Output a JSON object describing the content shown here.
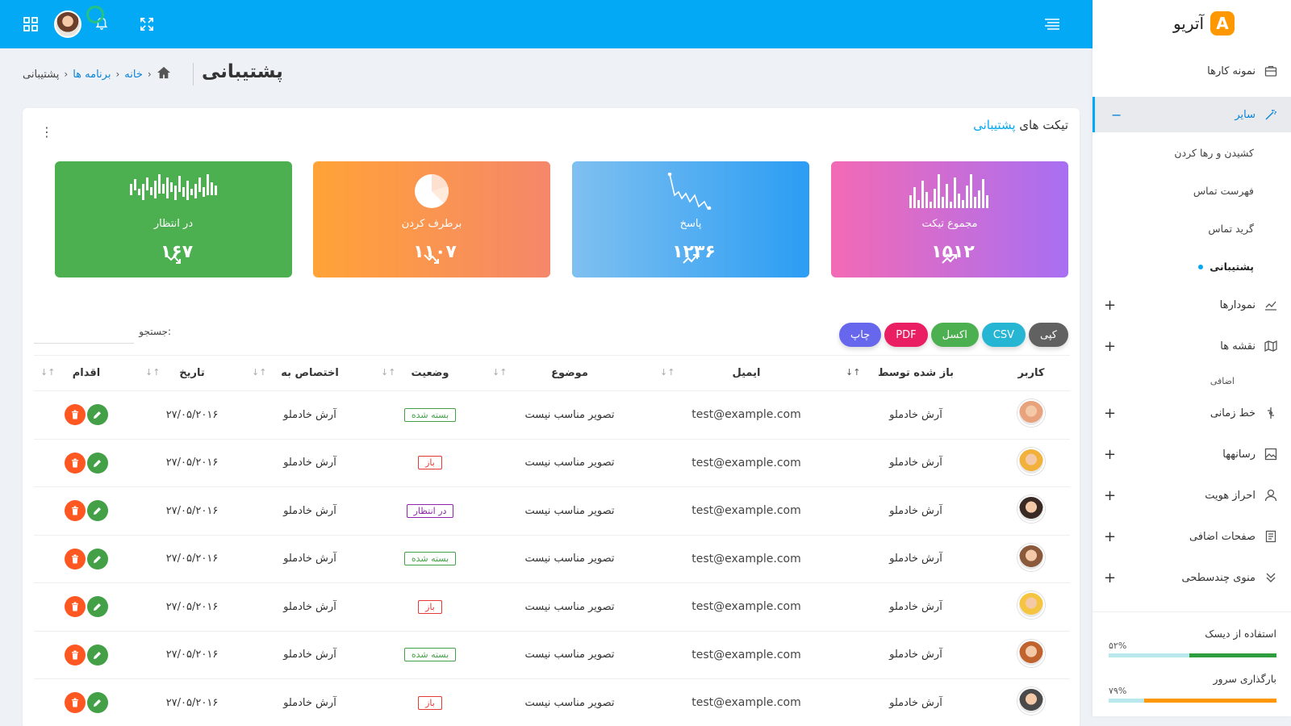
{
  "app": {
    "name": "آتریو",
    "logo_letter": "A"
  },
  "topbar": {
    "icons": [
      "grid-icon",
      "avatar",
      "bell-icon",
      "expand-icon",
      "menu-icon"
    ]
  },
  "page": {
    "title": "پشتیبانی",
    "breadcrumb": [
      "خانه",
      "برنامه ها",
      "پشتیبانی"
    ]
  },
  "sidebar": {
    "items": [
      {
        "label": "نمونه کارها",
        "icon": "briefcase-icon"
      },
      {
        "label": "سایر",
        "icon": "magic-wand-icon",
        "active": true
      }
    ],
    "subitems": [
      "کشیدن و رها کردن",
      "فهرست تماس",
      "گرید تماس",
      "پشتیبانی"
    ],
    "items2": [
      {
        "label": "نمودارها",
        "icon": "chart-line-icon"
      },
      {
        "label": "نقشه ها",
        "icon": "map-icon"
      }
    ],
    "section_label": "اضافی",
    "items3": [
      {
        "label": "خط زمانی",
        "icon": "timeline-icon"
      },
      {
        "label": "رسانهها",
        "icon": "image-icon"
      },
      {
        "label": "احراز هویت",
        "icon": "user-icon"
      },
      {
        "label": "صفحات اضافی",
        "icon": "page-icon"
      },
      {
        "label": "منوی چندسطحی",
        "icon": "chevrons-down-icon"
      }
    ],
    "meters": [
      {
        "label": "استفاده از دیسک",
        "percent": "۵۲%",
        "value": 52,
        "color": "#2e9e3e"
      },
      {
        "label": "بارگذاری سرور",
        "percent": "۷۹%",
        "value": 79,
        "color": "#ff9800"
      }
    ]
  },
  "card": {
    "title_part1": "تیکت های",
    "title_part2": "پشتیبانی"
  },
  "stats": [
    {
      "label": "مجموع تیکت",
      "value": "۱۵۱۲",
      "trend": "up",
      "gradient": [
        "#a86ff2",
        "#f36ab5"
      ]
    },
    {
      "label": "پاسخ",
      "value": "۱۲۳۶",
      "trend": "up",
      "gradient": [
        "#2b9df3",
        "#7fc0f0"
      ]
    },
    {
      "label": "برطرف کردن",
      "value": "۱۱۰۷",
      "trend": "down",
      "gradient": [
        "#f5876a",
        "#ffa337"
      ]
    },
    {
      "label": "در انتظار",
      "value": "۱۶۷",
      "trend": "down",
      "gradient": [
        "#4caf50",
        "#4caf50"
      ]
    }
  ],
  "export_buttons": [
    {
      "label": "کپی",
      "color": "#616161"
    },
    {
      "label": "CSV",
      "color": "#26b6d3"
    },
    {
      "label": "اکسل",
      "color": "#4caf50"
    },
    {
      "label": "PDF",
      "color": "#e91e63"
    },
    {
      "label": "چاپ",
      "color": "#6767ee"
    }
  ],
  "search": {
    "label": "جستجو:",
    "placeholder": ""
  },
  "table": {
    "columns": [
      "کاربر",
      "باز شده توسط",
      "ایمیل",
      "موضوع",
      "وضعیت",
      "اختصاص به",
      "تاریخ",
      "اقدام"
    ],
    "rows": [
      {
        "opened_by": "آرش خادملو",
        "email": "test@example.com",
        "subject": "تصویر مناسب نیست",
        "status": "بسته شده",
        "status_type": "closed",
        "assigned": "آرش خادملو",
        "date": "۲۷/۰۵/۲۰۱۶",
        "avatar_color": "#e8a27c"
      },
      {
        "opened_by": "آرش خادملو",
        "email": "test@example.com",
        "subject": "تصویر مناسب نیست",
        "status": "باز",
        "status_type": "open",
        "assigned": "آرش خادملو",
        "date": "۲۷/۰۵/۲۰۱۶",
        "avatar_color": "#f2b13a"
      },
      {
        "opened_by": "آرش خادملو",
        "email": "test@example.com",
        "subject": "تصویر مناسب نیست",
        "status": "در انتظار",
        "status_type": "pending",
        "assigned": "آرش خادملو",
        "date": "۲۷/۰۵/۲۰۱۶",
        "avatar_color": "#3a2a24"
      },
      {
        "opened_by": "آرش خادملو",
        "email": "test@example.com",
        "subject": "تصویر مناسب نیست",
        "status": "بسته شده",
        "status_type": "closed",
        "assigned": "آرش خادملو",
        "date": "۲۷/۰۵/۲۰۱۶",
        "avatar_color": "#8b5a3c"
      },
      {
        "opened_by": "آرش خادملو",
        "email": "test@example.com",
        "subject": "تصویر مناسب نیست",
        "status": "باز",
        "status_type": "open",
        "assigned": "آرش خادملو",
        "date": "۲۷/۰۵/۲۰۱۶",
        "avatar_color": "#f5c542"
      },
      {
        "opened_by": "آرش خادملو",
        "email": "test@example.com",
        "subject": "تصویر مناسب نیست",
        "status": "بسته شده",
        "status_type": "closed",
        "assigned": "آرش خادملو",
        "date": "۲۷/۰۵/۲۰۱۶",
        "avatar_color": "#c0632e"
      },
      {
        "opened_by": "آرش خادملو",
        "email": "test@example.com",
        "subject": "تصویر مناسب نیست",
        "status": "باز",
        "status_type": "open",
        "assigned": "آرش خادملو",
        "date": "۲۷/۰۵/۲۰۱۶",
        "avatar_color": "#4a4a4a"
      }
    ]
  }
}
